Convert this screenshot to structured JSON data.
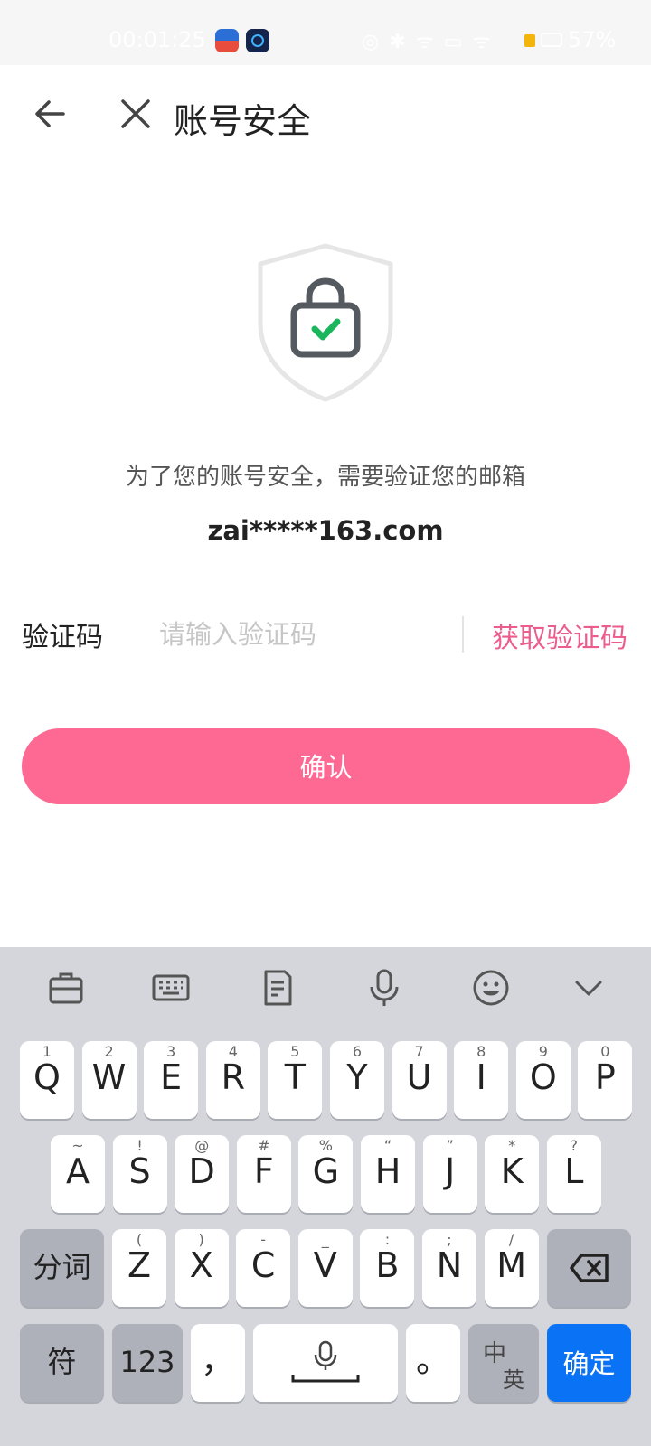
{
  "status_bar": {
    "time": "00:01:25",
    "indicators": "◎ ✱ ᯤ ▭ ᯤ",
    "battery": "57%"
  },
  "header": {
    "title": "账号安全"
  },
  "hero": {
    "description": "为了您的账号安全，需要验证您的邮箱",
    "email": "zai*****163.com"
  },
  "form": {
    "code_label": "验证码",
    "code_placeholder": "请输入验证码",
    "code_value": "",
    "get_code_label": "获取验证码",
    "confirm_label": "确认"
  },
  "keyboard": {
    "row1": [
      {
        "key": "Q",
        "sub": "1"
      },
      {
        "key": "W",
        "sub": "2"
      },
      {
        "key": "E",
        "sub": "3"
      },
      {
        "key": "R",
        "sub": "4"
      },
      {
        "key": "T",
        "sub": "5"
      },
      {
        "key": "Y",
        "sub": "6"
      },
      {
        "key": "U",
        "sub": "7"
      },
      {
        "key": "I",
        "sub": "8"
      },
      {
        "key": "O",
        "sub": "9"
      },
      {
        "key": "P",
        "sub": "0"
      }
    ],
    "row2": [
      {
        "key": "A",
        "sub": "~"
      },
      {
        "key": "S",
        "sub": "!"
      },
      {
        "key": "D",
        "sub": "@"
      },
      {
        "key": "F",
        "sub": "#"
      },
      {
        "key": "G",
        "sub": "%"
      },
      {
        "key": "H",
        "sub": "“"
      },
      {
        "key": "J",
        "sub": "”"
      },
      {
        "key": "K",
        "sub": "*"
      },
      {
        "key": "L",
        "sub": "?"
      }
    ],
    "row3": [
      {
        "key": "Z",
        "sub": "("
      },
      {
        "key": "X",
        "sub": ")"
      },
      {
        "key": "C",
        "sub": "-"
      },
      {
        "key": "V",
        "sub": "_"
      },
      {
        "key": "B",
        "sub": ":"
      },
      {
        "key": "N",
        "sub": ";"
      },
      {
        "key": "M",
        "sub": "/"
      }
    ],
    "segment_label": "分词",
    "symbol_label": "符",
    "number_label": "123",
    "comma_label": "，",
    "period_label": "。",
    "lang_top": "中",
    "lang_bottom": "英",
    "enter_label": "确定",
    "toolbar_icons": [
      "toolbox-icon",
      "keyboard-icon",
      "clipboard-icon",
      "microphone-icon",
      "emoji-icon",
      "chevron-down-icon"
    ]
  },
  "colors": {
    "accent": "#fe6994",
    "accent_text": "#ec5d8d",
    "keyboard_bg": "#d4d6dc",
    "enter_key": "#0a72f5"
  }
}
